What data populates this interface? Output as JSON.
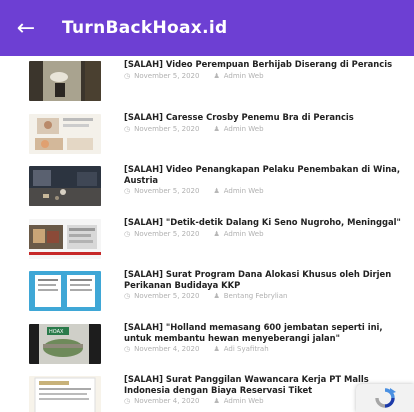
{
  "header": {
    "back_icon": "arrow-left-icon",
    "back_glyph": "←",
    "title": "TurnBackHoax.id",
    "color": "#6d3fd3"
  },
  "articles": [
    {
      "title": "[SALAH] Video Perempuan Berhijab Diserang di Perancis",
      "date": "November 5, 2020",
      "author": "Admin Web"
    },
    {
      "title": "[SALAH] Caresse Crosby Penemu Bra di Perancis",
      "date": "November 5, 2020",
      "author": "Admin Web"
    },
    {
      "title": "[SALAH] Video Penangkapan Pelaku Penembakan di Wina, Austria",
      "date": "November 5, 2020",
      "author": "Admin Web"
    },
    {
      "title": "[SALAH] \"Detik-detik Dalang Ki Seno Nugroho, Meninggal\"",
      "date": "November 5, 2020",
      "author": "Admin Web"
    },
    {
      "title": "[SALAH] Surat Program Dana Alokasi Khusus oleh Dirjen Perikanan Budidaya KKP",
      "date": "November 5, 2020",
      "author": "Bentang Febrylian"
    },
    {
      "title": "[SALAH] \"Holland memasang 600 jembatan seperti ini, untuk membantu hewan menyeberangi jalan\"",
      "date": "November 4, 2020",
      "author": "Adi Syafitrah"
    },
    {
      "title": "[SALAH] Surat Panggilan Wawancara Kerja PT Malls Indonesia dengan Biaya Reservasi Tiket",
      "date": "November 4, 2020",
      "author": "Admin Web"
    }
  ],
  "meta_icons": {
    "date": "clock-icon",
    "author": "person-icon"
  },
  "recaptcha": {
    "icon": "recaptcha-icon"
  }
}
